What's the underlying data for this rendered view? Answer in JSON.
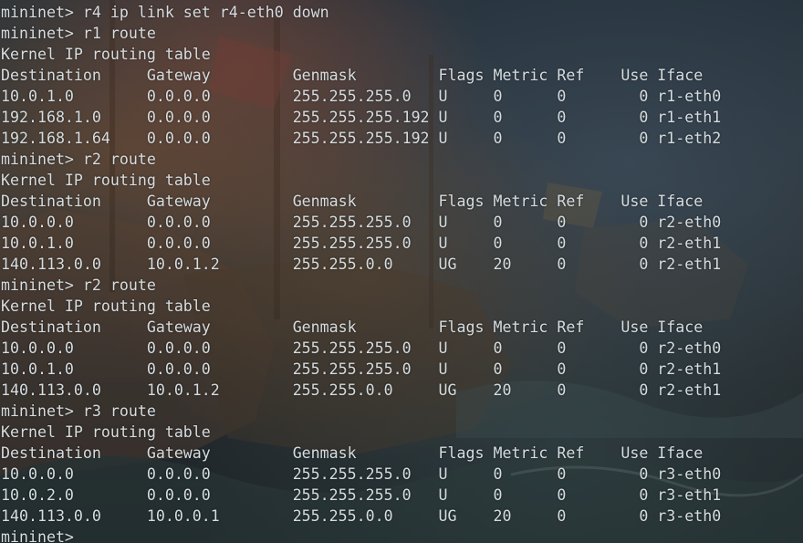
{
  "terminal": {
    "lines": [
      "mininet> r4 ip link set r4-eth0 down",
      "mininet> r1 route",
      "Kernel IP routing table",
      "Destination     Gateway         Genmask         Flags Metric Ref    Use Iface",
      "10.0.1.0        0.0.0.0         255.255.255.0   U     0      0        0 r1-eth0",
      "192.168.1.0     0.0.0.0         255.255.255.192 U     0      0        0 r1-eth1",
      "192.168.1.64    0.0.0.0         255.255.255.192 U     0      0        0 r1-eth2",
      "mininet> r2 route",
      "Kernel IP routing table",
      "Destination     Gateway         Genmask         Flags Metric Ref    Use Iface",
      "10.0.0.0        0.0.0.0         255.255.255.0   U     0      0        0 r2-eth0",
      "10.0.1.0        0.0.0.0         255.255.255.0   U     0      0        0 r2-eth1",
      "140.113.0.0     10.0.1.2        255.255.0.0     UG    20     0        0 r2-eth1",
      "mininet> r2 route",
      "Kernel IP routing table",
      "Destination     Gateway         Genmask         Flags Metric Ref    Use Iface",
      "10.0.0.0        0.0.0.0         255.255.255.0   U     0      0        0 r2-eth0",
      "10.0.1.0        0.0.0.0         255.255.255.0   U     0      0        0 r2-eth1",
      "140.113.0.0     10.0.1.2        255.255.0.0     UG    20     0        0 r2-eth1",
      "mininet> r3 route",
      "Kernel IP routing table",
      "Destination     Gateway         Genmask         Flags Metric Ref    Use Iface",
      "10.0.0.0        0.0.0.0         255.255.255.0   U     0      0        0 r3-eth0",
      "10.0.2.0        0.0.0.0         255.255.255.0   U     0      0        0 r3-eth1",
      "140.113.0.0     10.0.0.1        255.255.0.0     UG    20     0        0 r3-eth0",
      "mininet> "
    ]
  },
  "colors": {
    "text": "#d6dde0",
    "background": "#262e33"
  }
}
